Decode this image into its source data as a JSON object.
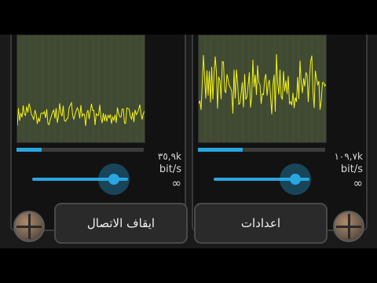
{
  "left_panel": {
    "rate": "٣٥,٩k",
    "unit": "bit/s",
    "infinity": "∞",
    "progress": 0.2,
    "slider": 0.85,
    "wave_level": 0.75
  },
  "right_panel": {
    "rate": "١٠٩,٧k",
    "unit": "bit/s",
    "infinity": "∞",
    "progress": 0.35,
    "slider": 0.85,
    "wave_level": 0.45
  },
  "buttons": {
    "stop_label": "ايقاف الاتصال",
    "settings_label": "اعدادات"
  },
  "colors": {
    "accent": "#29a6e0",
    "waveform": "#f2f21a",
    "wave_bg": "#404a32"
  }
}
